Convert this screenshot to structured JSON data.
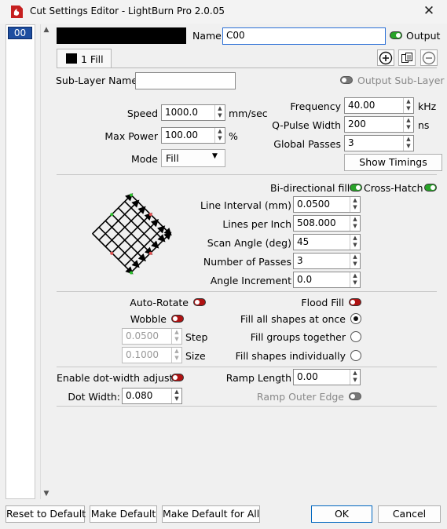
{
  "window": {
    "title": "Cut Settings Editor - LightBurn Pro 2.0.05",
    "close_icon": "close-icon"
  },
  "layer_list": {
    "items": [
      "00"
    ]
  },
  "header": {
    "layer_color": "#000000",
    "name_label": "Name",
    "name_value": "C00",
    "output_label": "Output",
    "output_on": true,
    "tab_label": "1 Fill",
    "actions": [
      "add-sublayer-icon",
      "duplicate-sublayer-icon",
      "remove-sublayer-icon"
    ]
  },
  "sublayer": {
    "label": "Sub-Layer Name",
    "value": "",
    "output_label": "Output Sub-Layer"
  },
  "speed": {
    "label": "Speed",
    "value": "1000.0",
    "unit": "mm/sec"
  },
  "max_power": {
    "label": "Max Power",
    "value": "100.00",
    "unit": "%"
  },
  "mode": {
    "label": "Mode",
    "value": "Fill"
  },
  "frequency": {
    "label": "Frequency",
    "value": "40.00",
    "unit": "kHz"
  },
  "q_pulse": {
    "label": "Q-Pulse Width",
    "value": "200",
    "unit": "ns"
  },
  "global_passes": {
    "label": "Global Passes",
    "value": "3"
  },
  "show_timings": "Show Timings",
  "fill": {
    "bidirectional_label": "Bi-directional fill",
    "crosshatch_label": "Cross-Hatch",
    "line_interval": {
      "label": "Line Interval (mm)",
      "value": "0.0500"
    },
    "lines_per_inch": {
      "label": "Lines per Inch",
      "value": "508.000"
    },
    "scan_angle": {
      "label": "Scan Angle (deg)",
      "value": "45"
    },
    "num_passes": {
      "label": "Number of Passes",
      "value": "3"
    },
    "angle_increment": {
      "label": "Angle Increment",
      "value": "0.0"
    }
  },
  "options": {
    "auto_rotate": "Auto-Rotate",
    "wobble": "Wobble",
    "step_value": "0.0500",
    "step_label": "Step",
    "size_value": "0.1000",
    "size_label": "Size",
    "flood_fill": "Flood Fill",
    "fill_all": "Fill all shapes at once",
    "fill_groups": "Fill groups together",
    "fill_individually": "Fill shapes individually"
  },
  "dot": {
    "enable_label": "Enable dot-width adjust",
    "width_label": "Dot Width:",
    "width_value": "0.080",
    "ramp_label": "Ramp Length",
    "ramp_value": "0.00",
    "ramp_outer_label": "Ramp Outer Edge"
  },
  "footer": {
    "reset": "Reset to Default",
    "make_default": "Make Default",
    "make_default_all": "Make Default for All",
    "ok": "OK",
    "cancel": "Cancel"
  }
}
